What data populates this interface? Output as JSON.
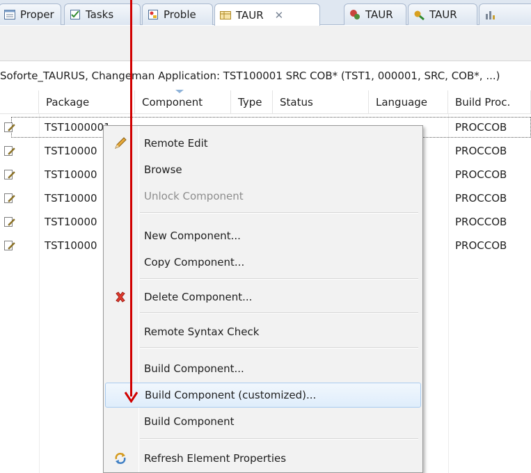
{
  "tabs": [
    {
      "label": "Proper",
      "icon": "properties-icon"
    },
    {
      "label": "Tasks",
      "icon": "tasks-icon"
    },
    {
      "label": "Proble",
      "icon": "problems-icon"
    },
    {
      "label": "TAUR",
      "icon": "taurus-table-icon",
      "active": true,
      "close": "✕"
    },
    {
      "label": "TAUR",
      "icon": "taurus-search-icon"
    },
    {
      "label": "TAUR",
      "icon": "taurus-tools-icon"
    },
    {
      "label": "",
      "icon": "taurus-chart-icon"
    }
  ],
  "view_title": "Soforte_TAURUS, Changeman Application: TST100001 SRC COB* (TST1, 000001, SRC, COB*, ...)",
  "table": {
    "columns": [
      "Package",
      "Component",
      "Type",
      "Status",
      "Language",
      "Build Proc."
    ],
    "sorted_column": "Component",
    "rows": [
      {
        "package": "TST1000001",
        "build_proc": "PROCCOB",
        "selected": true
      },
      {
        "package": "TST10000",
        "build_proc": "PROCCOB"
      },
      {
        "package": "TST10000",
        "build_proc": "PROCCOB"
      },
      {
        "package": "TST10000",
        "build_proc": "PROCCOB"
      },
      {
        "package": "TST10000",
        "build_proc": "PROCCOB"
      },
      {
        "package": "TST10000",
        "build_proc": "PROCCOB"
      }
    ]
  },
  "context_menu": {
    "items": [
      {
        "label": "Remote Edit",
        "icon": "pencil-icon"
      },
      {
        "label": "Browse"
      },
      {
        "label": "Unlock Component",
        "disabled": true
      },
      {
        "label": "New Component..."
      },
      {
        "label": "Copy Component..."
      },
      {
        "label": "Delete Component...",
        "icon": "red-x-icon"
      },
      {
        "label": "Remote Syntax Check"
      },
      {
        "label": "Build Component..."
      },
      {
        "label": "Build Component (customized)...",
        "highlighted": true
      },
      {
        "label": "Build Component"
      },
      {
        "label": "Refresh Element Properties",
        "icon": "refresh-icon"
      }
    ]
  },
  "colors": {
    "annotation_arrow": "#d10000",
    "menu_highlight_border": "#a8cbef",
    "tab_bar": "#dfe7f1"
  }
}
